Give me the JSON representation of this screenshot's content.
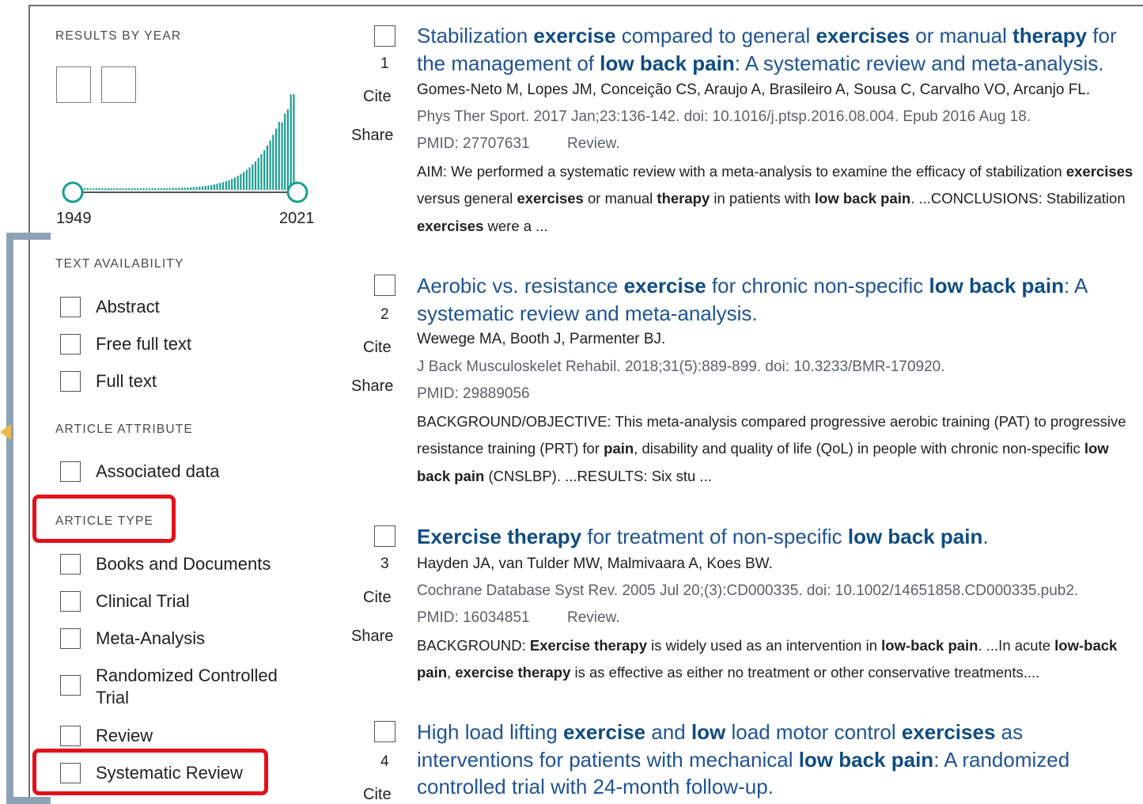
{
  "sidebar": {
    "results_by_year": {
      "title": "RESULTS BY YEAR",
      "start_year": "1949",
      "end_year": "2021"
    },
    "text_availability": {
      "title": "TEXT AVAILABILITY",
      "items": [
        "Abstract",
        "Free full text",
        "Full text"
      ]
    },
    "article_attribute": {
      "title": "ARTICLE ATTRIBUTE",
      "items": [
        "Associated data"
      ]
    },
    "article_type": {
      "title": "ARTICLE TYPE",
      "items": [
        "Books and Documents",
        "Clinical Trial",
        "Meta-Analysis",
        "Randomized Controlled Trial",
        "Review",
        "Systematic Review"
      ]
    }
  },
  "actions": {
    "cite": "Cite",
    "share": "Share"
  },
  "results": [
    {
      "number": "1",
      "authors": "Gomes-Neto M, Lopes JM, Conceição CS, Araujo A, Brasileiro A, Sousa C, Carvalho VO, Arcanjo FL.",
      "citation": "Phys Ther Sport. 2017 Jan;23:136-142. doi: 10.1016/j.ptsp.2016.08.004. Epub 2016 Aug 18.",
      "pmid": "PMID: 27707631",
      "type": "Review."
    },
    {
      "number": "2",
      "authors": "Wewege MA, Booth J, Parmenter BJ.",
      "citation": "J Back Musculoskelet Rehabil. 2018;31(5):889-899. doi: 10.3233/BMR-170920.",
      "pmid": "PMID: 29889056"
    },
    {
      "number": "3",
      "authors": "Hayden JA, van Tulder MW, Malmivaara A, Koes BW.",
      "citation": "Cochrane Database Syst Rev. 2005 Jul 20;(3):CD000335. doi: 10.1002/14651858.CD000335.pub2.",
      "pmid": "PMID: 16034851",
      "type": "Review."
    },
    {
      "number": "4"
    }
  ],
  "rich": {
    "r1_title": "Stabilization <b>exercise</b> compared to general <b>exercises</b> or manual <b>therapy</b> for the management of <b>low back pain</b>: A systematic review and meta-analysis.",
    "r1_snippet": "AIM: We performed a systematic review with a meta-analysis to examine the efficacy of stabilization <b>exercises</b> versus general <b>exercises</b> or manual <b>therapy</b> in patients with <b>low back pain</b>. ...CONCLUSIONS: Stabilization <b>exercises</b> were a ...",
    "r2_title": "Aerobic vs. resistance <b>exercise</b> for chronic non-specific <b>low back pain</b>: A systematic review and meta-analysis.",
    "r2_snippet": "BACKGROUND/OBJECTIVE: This meta-analysis compared progressive aerobic training (PAT) to progressive resistance training (PRT) for <b>pain</b>, disability and quality of life (QoL) in people with chronic non-specific <b>low back pain</b> (CNSLBP). ...RESULTS: Six stu ...",
    "r3_title": "<b>Exercise therapy</b> for treatment of non-specific <b>low back pain</b>.",
    "r3_snippet": "BACKGROUND: <b>Exercise therapy</b> is widely used as an intervention in <b>low-back pain</b>. ...In acute <b>low-back pain</b>, <b>exercise therapy</b> is as effective as either no treatment or other conservative treatments....",
    "r4_title": "High load lifting <b>exercise</b> and <b>low</b> load motor control <b>exercises</b> as interventions for patients with mechanical <b>low back pain</b>: A randomized controlled trial with 24-month follow-up."
  },
  "colors": {
    "highlight_box": "#e3101a",
    "histogram_bar": "#1a9e8f",
    "title_link": "#205493"
  }
}
